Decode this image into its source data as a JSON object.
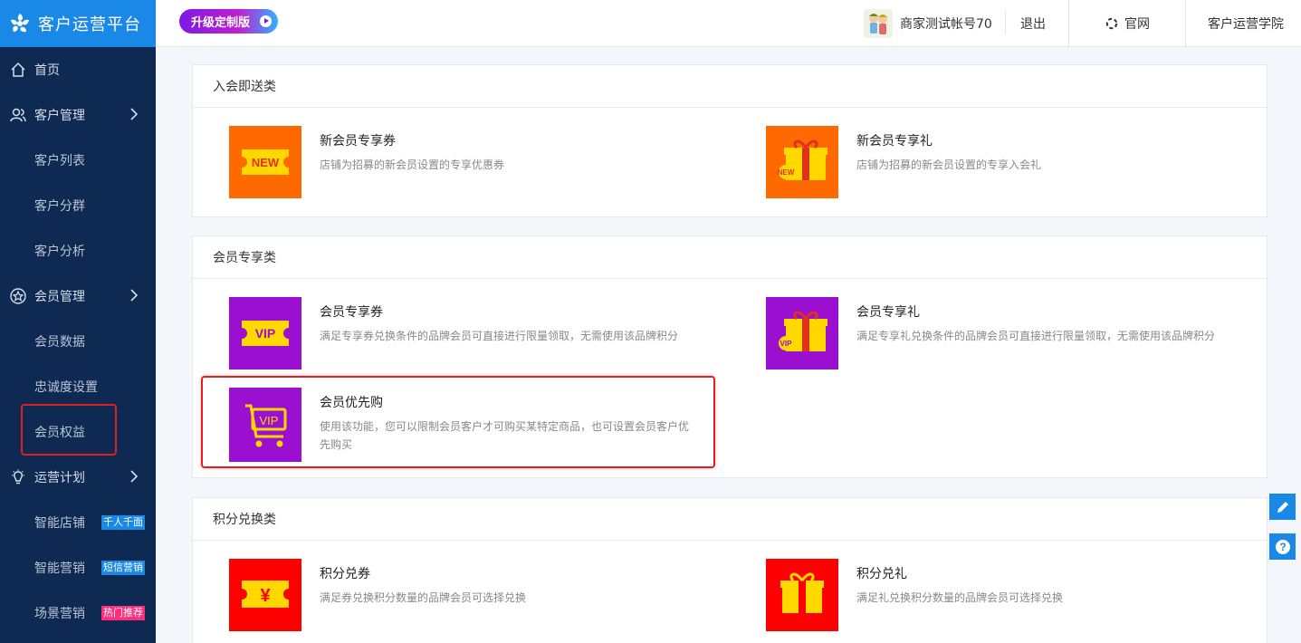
{
  "brand": {
    "title": "客户运营平台"
  },
  "sidebar": {
    "items": [
      {
        "label": "首页",
        "icon": "home-icon",
        "type": "top"
      },
      {
        "label": "客户管理",
        "icon": "user-group-icon",
        "type": "top",
        "expandable": true
      },
      {
        "label": "客户列表",
        "type": "sub"
      },
      {
        "label": "客户分群",
        "type": "sub"
      },
      {
        "label": "客户分析",
        "type": "sub"
      },
      {
        "label": "会员管理",
        "icon": "star-icon",
        "type": "top",
        "expandable": true
      },
      {
        "label": "会员数据",
        "type": "sub"
      },
      {
        "label": "忠诚度设置",
        "type": "sub"
      },
      {
        "label": "会员权益",
        "type": "sub",
        "active": true
      },
      {
        "label": "运营计划",
        "icon": "lightbulb-icon",
        "type": "top",
        "expandable": true
      },
      {
        "label": "智能店铺",
        "type": "sub",
        "badge": "千人千面",
        "badge_color": "#1a88e6"
      },
      {
        "label": "智能营销",
        "type": "sub",
        "badge": "短信营销",
        "badge_color": "#1a88e6"
      },
      {
        "label": "场景营销",
        "type": "sub",
        "badge": "热门推荐",
        "badge_color": "#ff2d7a"
      }
    ]
  },
  "topbar": {
    "upgrade_label": "升级定制版",
    "merchant_name": "商家测试帐号70",
    "logout_label": "退出",
    "official_site_label": "官网",
    "academy_label": "客户运营学院"
  },
  "sections": [
    {
      "title": "入会即送类",
      "cards": [
        {
          "title": "新会员专享券",
          "desc": "店铺为招募的新会员设置的专享优惠券",
          "thumb_bg": "#ff6a00",
          "icon": "new-coupon-icon",
          "icon_text": "NEW"
        },
        {
          "title": "新会员专享礼",
          "desc": "店铺为招募的新会员设置的专享入会礼",
          "thumb_bg": "#ff6a00",
          "icon": "new-gift-icon",
          "icon_text": "NEW"
        }
      ]
    },
    {
      "title": "会员专享类",
      "cards": [
        {
          "title": "会员专享券",
          "desc": "满足专享券兑换条件的品牌会员可直接进行限量领取，无需使用该品牌积分",
          "thumb_bg": "#9b0fd0",
          "icon": "vip-coupon-icon",
          "icon_text": "VIP"
        },
        {
          "title": "会员专享礼",
          "desc": "满足专享礼兑换条件的品牌会员可直接进行限量领取，无需使用该品牌积分",
          "thumb_bg": "#9b0fd0",
          "icon": "vip-gift-icon",
          "icon_text": "VIP"
        },
        {
          "title": "会员优先购",
          "desc": "使用该功能，您可以限制会员客户才可购买某特定商品，也可设置会员客户优先购买",
          "thumb_bg": "#9b0fd0",
          "icon": "vip-cart-icon",
          "icon_text": "VIP"
        }
      ]
    },
    {
      "title": "积分兑换类",
      "cards": [
        {
          "title": "积分兑券",
          "desc": "满足券兑换积分数量的品牌会员可选择兑换",
          "thumb_bg": "#ff0000",
          "icon": "yen-coupon-icon",
          "icon_text": "¥"
        },
        {
          "title": "积分兑礼",
          "desc": "满足礼兑换积分数量的品牌会员可选择兑换",
          "thumb_bg": "#ff0000",
          "icon": "points-gift-icon"
        }
      ]
    }
  ],
  "floating": {
    "edit_icon": "pencil-icon",
    "help_icon": "question-icon",
    "help_text": "?"
  }
}
